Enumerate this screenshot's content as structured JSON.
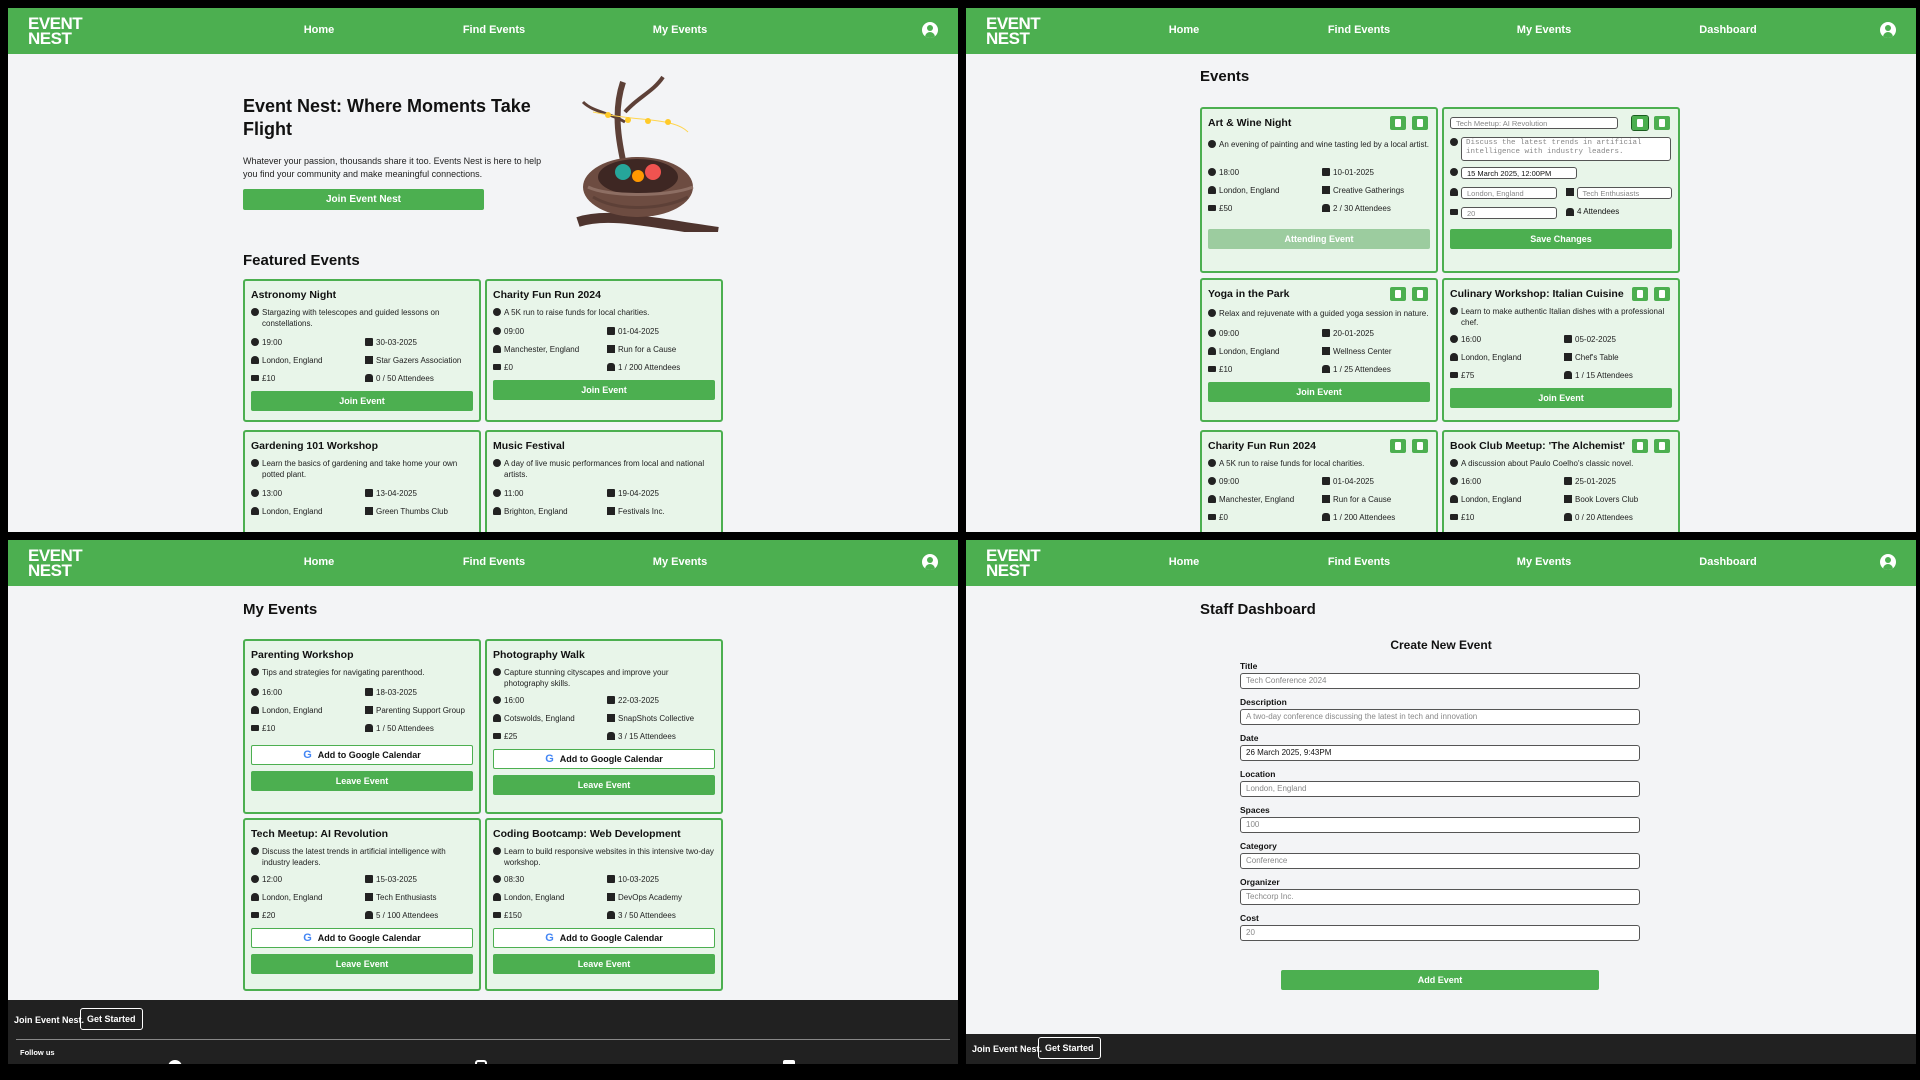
{
  "colors": {
    "brand": "#4caf50",
    "card_bg": "#e8f5e9",
    "footer_bg": "#212121",
    "page_bg": "#f3f4f6"
  },
  "nav": {
    "logo_line1": "EVENT",
    "logo_line2": "NEST",
    "home": "Home",
    "find": "Find Events",
    "my": "My Events",
    "dashboard": "Dashboard",
    "user_icon": "user-circle-icon"
  },
  "home": {
    "hero_title": "Event Nest: Where Moments Take Flight",
    "hero_text": "Whatever your passion, thousands share it too. Events Nest is here to help you find your community and make meaningful connections.",
    "join_button": "Join Event Nest",
    "featured_title": "Featured Events",
    "cards": [
      {
        "title": "Astronomy Night",
        "desc": "Stargazing with telescopes and guided lessons on constellations.",
        "time": "19:00",
        "date": "30-03-2025",
        "location": "London, England",
        "organizer": "Star Gazers Association",
        "cost": "£10",
        "attendees": "0 / 50 Attendees",
        "button": "Join Event"
      },
      {
        "title": "Charity Fun Run 2024",
        "desc": "A 5K run to raise funds for local charities.",
        "time": "09:00",
        "date": "01-04-2025",
        "location": "Manchester, England",
        "organizer": "Run for a Cause",
        "cost": "£0",
        "attendees": "1 / 200 Attendees",
        "button": "Join Event"
      },
      {
        "title": "Gardening 101 Workshop",
        "desc": "Learn the basics of gardening and take home your own potted plant.",
        "time": "13:00",
        "date": "13-04-2025",
        "location": "London, England",
        "organizer": "Green Thumbs Club"
      },
      {
        "title": "Music Festival",
        "desc": "A day of live music performances from local and national artists.",
        "time": "11:00",
        "date": "19-04-2025",
        "location": "Brighton, England",
        "organizer": "Festivals Inc."
      }
    ]
  },
  "events": {
    "title": "Events",
    "art": {
      "title": "Art & Wine Night",
      "desc": "An evening of painting and wine tasting led by a local artist.",
      "time": "18:00",
      "date": "10-01-2025",
      "location": "London, England",
      "organizer": "Creative Gatherings",
      "cost": "£50",
      "attendees": "2 / 30 Attendees",
      "button": "Attending Event"
    },
    "edit": {
      "title": "Tech Meetup: AI Revolution",
      "desc": "Discuss the latest trends in artificial intelligence with industry leaders.",
      "date": "15 March 2025, 12:00PM",
      "location": "London, England",
      "organizer": "Tech Enthusiasts",
      "cost": "20",
      "attendees": "4 Attendees",
      "button": "Save Changes"
    },
    "cards": [
      {
        "title": "Yoga in the Park",
        "desc": "Relax and rejuvenate with a guided yoga session in nature.",
        "time": "09:00",
        "date": "20-01-2025",
        "location": "London, England",
        "organizer": "Wellness Center",
        "cost": "£10",
        "attendees": "1 / 25 Attendees",
        "button": "Join Event"
      },
      {
        "title": "Culinary Workshop: Italian Cuisine",
        "desc": "Learn to make authentic Italian dishes with a professional chef.",
        "time": "16:00",
        "date": "05-02-2025",
        "location": "London, England",
        "organizer": "Chef's Table",
        "cost": "£75",
        "attendees": "1 / 15 Attendees",
        "button": "Join Event"
      },
      {
        "title": "Charity Fun Run 2024",
        "desc": "A 5K run to raise funds for local charities.",
        "time": "09:00",
        "date": "01-04-2025",
        "location": "Manchester, England",
        "organizer": "Run for a Cause",
        "cost": "£0",
        "attendees": "1 / 200 Attendees"
      },
      {
        "title": "Book Club Meetup: 'The Alchemist'",
        "desc": "A discussion about Paulo Coelho's classic novel.",
        "time": "16:00",
        "date": "25-01-2025",
        "location": "London, England",
        "organizer": "Book Lovers Club",
        "cost": "£10",
        "attendees": "0 / 20 Attendees"
      }
    ]
  },
  "my": {
    "title": "My Events",
    "gcal": "Add to Google Calendar",
    "leave": "Leave Event",
    "cards": [
      {
        "title": "Parenting Workshop",
        "desc": "Tips and strategies for navigating parenthood.",
        "time": "16:00",
        "date": "18-03-2025",
        "location": "London, England",
        "organizer": "Parenting Support Group",
        "cost": "£10",
        "attendees": "1 / 50 Attendees"
      },
      {
        "title": "Photography Walk",
        "desc": "Capture stunning cityscapes and improve your photography skills.",
        "time": "16:00",
        "date": "22-03-2025",
        "location": "Cotswolds, England",
        "organizer": "SnapShots Collective",
        "cost": "£25",
        "attendees": "3 / 15 Attendees"
      },
      {
        "title": "Tech Meetup: AI Revolution",
        "desc": "Discuss the latest trends in artificial intelligence with industry leaders.",
        "time": "12:00",
        "date": "15-03-2025",
        "location": "London, England",
        "organizer": "Tech Enthusiasts",
        "cost": "£20",
        "attendees": "5 / 100 Attendees"
      },
      {
        "title": "Coding Bootcamp: Web Development",
        "desc": "Learn to build responsive websites in this intensive two-day workshop.",
        "time": "08:30",
        "date": "10-03-2025",
        "location": "London, England",
        "organizer": "DevOps Academy",
        "cost": "£150",
        "attendees": "3 / 50 Attendees"
      }
    ]
  },
  "dash": {
    "title": "Staff Dashboard",
    "form_title": "Create New Event",
    "fields": [
      {
        "label": "Title",
        "placeholder": "Tech Conference 2024"
      },
      {
        "label": "Description",
        "placeholder": "A two-day conference discussing the latest in tech and innovation"
      },
      {
        "label": "Date",
        "value": "26 March 2025, 9:43PM"
      },
      {
        "label": "Location",
        "placeholder": "London, England"
      },
      {
        "label": "Spaces",
        "placeholder": "100"
      },
      {
        "label": "Category",
        "placeholder": "Conference"
      },
      {
        "label": "Organizer",
        "placeholder": "Techcorp Inc."
      },
      {
        "label": "Cost",
        "placeholder": "20"
      }
    ],
    "submit": "Add Event"
  },
  "footer": {
    "join_text": "Join Event Nest.",
    "get_started": "Get Started",
    "follow": "Follow us",
    "social_icons": [
      "facebook-icon",
      "instagram-icon",
      "x-icon"
    ]
  }
}
